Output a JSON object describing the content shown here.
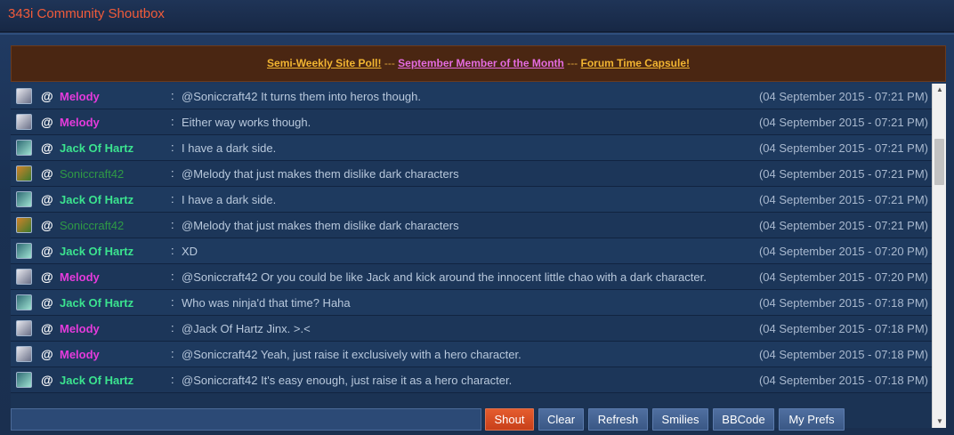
{
  "window": {
    "title": "343i Community Shoutbox"
  },
  "announcement": {
    "link1": "Semi-Weekly Site Poll!",
    "sep1": " --- ",
    "link2": "September Member of the Month",
    "sep2": " --- ",
    "link3": "Forum Time Capsule!"
  },
  "messages": [
    {
      "avatar": "melody-avatar",
      "user": "Melody",
      "text": "@Soniccraft42 It turns them into heros though.",
      "time": "(04 September 2015 - 07:21 PM)"
    },
    {
      "avatar": "melody-avatar",
      "user": "Melody",
      "text": "Either way works though.",
      "time": "(04 September 2015 - 07:21 PM)"
    },
    {
      "avatar": "jack-avatar",
      "user": "Jack Of Hartz",
      "text": "I have a dark side.",
      "time": "(04 September 2015 - 07:21 PM)"
    },
    {
      "avatar": "sonic-avatar",
      "user": "Soniccraft42",
      "text": "@Melody that just makes them dislike dark characters",
      "time": "(04 September 2015 - 07:21 PM)"
    },
    {
      "avatar": "jack-avatar",
      "user": "Jack Of Hartz",
      "text": "I have a dark side.",
      "time": "(04 September 2015 - 07:21 PM)"
    },
    {
      "avatar": "sonic-avatar",
      "user": "Soniccraft42",
      "text": "@Melody that just makes them dislike dark characters",
      "time": "(04 September 2015 - 07:21 PM)"
    },
    {
      "avatar": "jack-avatar",
      "user": "Jack Of Hartz",
      "text": "XD",
      "time": "(04 September 2015 - 07:20 PM)"
    },
    {
      "avatar": "melody-avatar",
      "user": "Melody",
      "text": "@Soniccraft42 Or you could be like Jack and kick around the innocent little chao with a dark character.",
      "time": "(04 September 2015 - 07:20 PM)"
    },
    {
      "avatar": "jack-avatar",
      "user": "Jack Of Hartz",
      "text": "Who was ninja'd that time? Haha",
      "time": "(04 September 2015 - 07:18 PM)"
    },
    {
      "avatar": "melody-avatar",
      "user": "Melody",
      "text": "@Jack Of Hartz Jinx. >.<",
      "time": "(04 September 2015 - 07:18 PM)"
    },
    {
      "avatar": "melody-avatar",
      "user": "Melody",
      "text": "@Soniccraft42 Yeah, just raise it exclusively with a hero character.",
      "time": "(04 September 2015 - 07:18 PM)"
    },
    {
      "avatar": "jack-avatar",
      "user": "Jack Of Hartz",
      "text": "@Soniccraft42 It's easy enough, just raise it as a hero character.",
      "time": "(04 September 2015 - 07:18 PM)"
    }
  ],
  "row": {
    "at": "@",
    "colon": ":"
  },
  "input": {
    "value": "",
    "placeholder": ""
  },
  "buttons": {
    "shout": "Shout",
    "clear": "Clear",
    "refresh": "Refresh",
    "smilies": "Smilies",
    "bbcode": "BBCode",
    "prefs": "My Prefs"
  },
  "scrollbar": {
    "up": "▲",
    "down": "▼"
  },
  "colors": {
    "accent": "#f15b3a",
    "melody": "#e53bdc",
    "jack": "#3be38f",
    "sonic": "#2f9a45",
    "shout_button": "#d9481f"
  }
}
